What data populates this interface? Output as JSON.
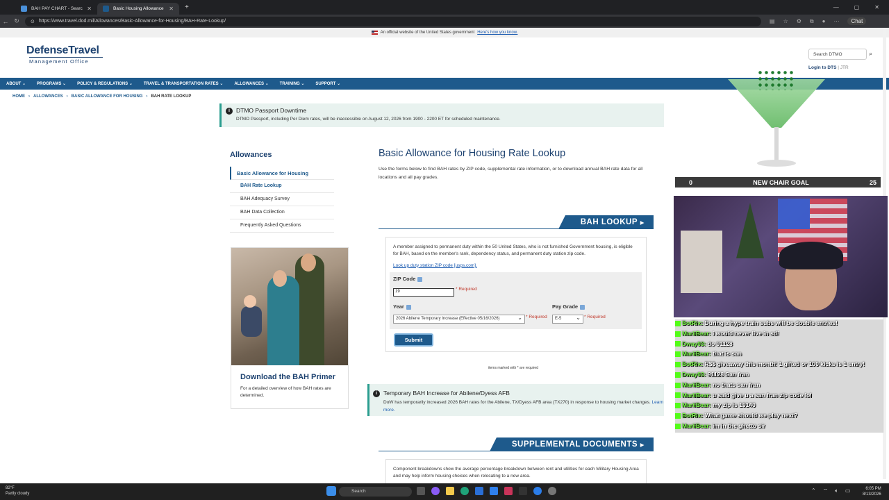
{
  "browser": {
    "tabs": [
      {
        "label": "BAH PAY CHART - Search",
        "active": false
      },
      {
        "label": "Basic Housing Allowance | BAH R...",
        "active": true
      }
    ],
    "url": "https://www.travel.dod.mil/Allowances/Basic-Allowance-for-Housing/BAH-Rate-Lookup/",
    "chat_button": "Chat"
  },
  "gov_banner": {
    "text": "An official website of the United States government",
    "link": "Here's how you know."
  },
  "logo": {
    "line1": "DefenseTravel",
    "line2": "Management Office"
  },
  "header": {
    "search_placeholder": "Search DTMO",
    "login_label": "Login to DTS",
    "separator": "|",
    "jtr_label": "JTR"
  },
  "nav": {
    "items": [
      "ABOUT ⌄",
      "PROGRAMS ⌄",
      "POLICY & REGULATIONS ⌄",
      "TRAVEL & TRANSPORTATION RATES ⌄",
      "ALLOWANCES ⌄",
      "TRAINING ⌄",
      "SUPPORT ⌄"
    ]
  },
  "breadcrumb": {
    "items": [
      "HOME",
      "›",
      "ALLOWANCES",
      "›",
      "BASIC ALLOWANCE FOR HOUSING",
      "›"
    ],
    "current": "BAH RATE LOOKUP"
  },
  "downtime_alert": {
    "title": "DTMO Passport Downtime",
    "body": "DTMO Passport, including Per Diem rates, will be inaccessible on August 12, 2026 from 1900 - 2200 ET for scheduled maintenance."
  },
  "sidebar": {
    "heading": "Allowances",
    "items": [
      {
        "label": "Basic Allowance for Housing"
      },
      {
        "label": "BAH Rate Lookup"
      },
      {
        "label": "BAH Adequacy Survey"
      },
      {
        "label": "BAH Data Collection"
      },
      {
        "label": "Frequently Asked Questions"
      }
    ]
  },
  "primer": {
    "title": "Download the BAH Primer",
    "desc": "For a detailed overview of how BAH rates are determined."
  },
  "main": {
    "title": "Basic Allowance for Housing Rate Lookup",
    "desc": "Use the forms below to find BAH rates by ZIP code, supplemental rate information, or to download annual BAH rate data for all locations and all pay grades."
  },
  "lookup": {
    "section_label": "BAH LOOKUP",
    "desc": "A member assigned to permanent duty within the 50 United States, who is not furnished Government housing, is eligible for BAH, based on the member's rank, dependency status, and permanent duty station zip code.",
    "link": "Look up duty station ZIP code [usps.com].",
    "zip_label": "ZIP Code",
    "zip_value": "19",
    "required": "* Required",
    "year_label": "Year",
    "year_value": "2026 Abilene Temporary Increase (Effective 05/16/2026)",
    "paygrade_label": "Pay Grade",
    "paygrade_value": "E-5",
    "submit_label": "Submit",
    "required_note": "items marked with * are required"
  },
  "abilene_alert": {
    "title": "Temporary BAH Increase for Abilene/Dyess AFB",
    "body": "DoW has temporarily increased 2026 BAH rates for the Abilene, TX/Dyess AFB area (TX270) in response to housing market changes.",
    "link": "Learn more."
  },
  "supplemental": {
    "section_label": "SUPPLEMENTAL DOCUMENTS",
    "desc": "Component breakdowns show the average percentage breakdown between rent and utilities for each Military Housing Area and may help inform housing choices when relocating to a new area."
  },
  "stream": {
    "goal_start": "0",
    "goal_label": "NEW CHAIR GOAL",
    "goal_end": "25",
    "chat": [
      {
        "user": "BotRix:",
        "text": "During a hype train subs will be double entries!"
      },
      {
        "user": "MariiBear:",
        "text": "i would never live in sd!"
      },
      {
        "user": "Dway03:",
        "text": "do 91128"
      },
      {
        "user": "MariiBear:",
        "text": "that is san"
      },
      {
        "user": "BotRix:",
        "text": "R$$ giveaway this month! 1 gifted or 100 kicks is 1 entry!"
      },
      {
        "user": "Dway03:",
        "text": "91128 San fran"
      },
      {
        "user": "MariiBear:",
        "text": "no thats san fran"
      },
      {
        "user": "MariiBear:",
        "text": "u said give u a san fran zip code lol"
      },
      {
        "user": "MariiBear:",
        "text": "my zip is 19140"
      },
      {
        "user": "BotRix:",
        "text": "What game should we play next?"
      },
      {
        "user": "MariiBear:",
        "text": "im in the ghetto sir"
      }
    ]
  },
  "taskbar": {
    "temp": "82°F",
    "weather": "Partly cloudy",
    "search": "Search",
    "time": "6:05 PM",
    "date": "8/13/2026"
  },
  "colors": {
    "brand_blue": "#1e5a8c",
    "navy": "#1d4270",
    "alert_teal": "#2a9d8f",
    "required_red": "#c0392b",
    "chat_user_green": "#7cfc4a"
  }
}
